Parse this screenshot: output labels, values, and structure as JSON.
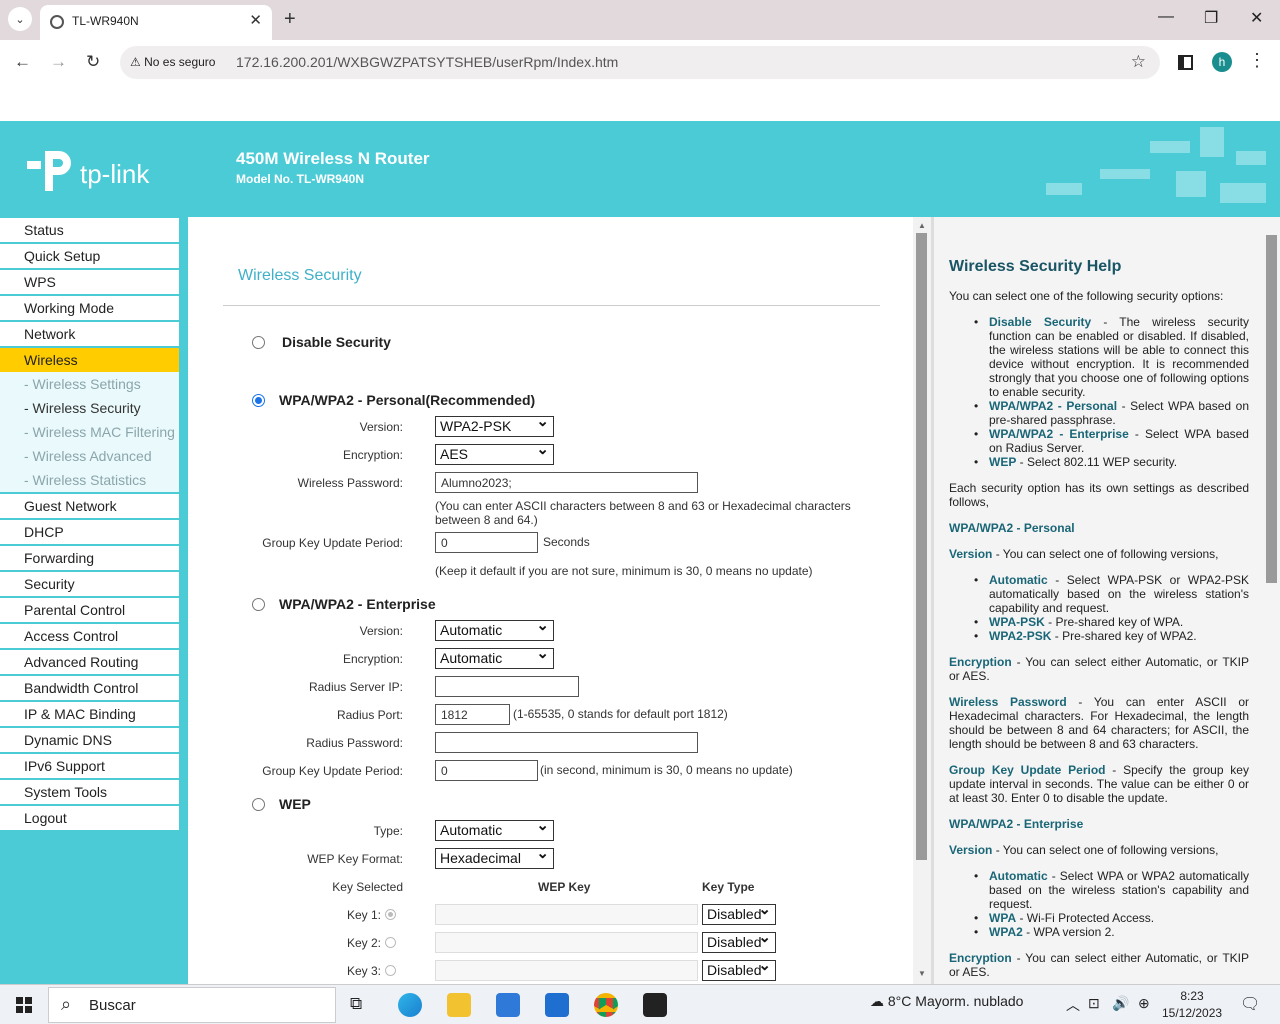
{
  "browser": {
    "tab_title": "TL-WR940N",
    "security_label": "No es seguro",
    "url": "172.16.200.201/WXBGWZPATSYTSHEB/userRpm/Index.htm",
    "avatar_letter": "h"
  },
  "header": {
    "logo_text": "tp-link",
    "product_title": "450M Wireless N Router",
    "model_no": "Model No. TL-WR940N"
  },
  "sidebar": {
    "items": [
      "Status",
      "Quick Setup",
      "WPS",
      "Working Mode",
      "Network",
      "Wireless"
    ],
    "sub_items": [
      "- Wireless Settings",
      "- Wireless Security",
      "- Wireless MAC Filtering",
      "- Wireless Advanced",
      "- Wireless Statistics"
    ],
    "items_after": [
      "Guest Network",
      "DHCP",
      "Forwarding",
      "Security",
      "Parental Control",
      "Access Control",
      "Advanced Routing",
      "Bandwidth Control",
      "IP & MAC Binding",
      "Dynamic DNS",
      "IPv6 Support",
      "System Tools",
      "Logout"
    ]
  },
  "main": {
    "page_title": "Wireless Security",
    "disable": {
      "label": "Disable Security"
    },
    "personal": {
      "label": "WPA/WPA2 - Personal(Recommended)",
      "version_label": "Version:",
      "version": "WPA2-PSK",
      "encryption_label": "Encryption:",
      "encryption": "AES",
      "password_label": "Wireless Password:",
      "password": "Alumno2023;",
      "password_note": "(You can enter ASCII characters between 8 and 63 or Hexadecimal characters between 8 and 64.)",
      "gkup_label": "Group Key Update Period:",
      "gkup": "0",
      "seconds": "Seconds",
      "gkup_note": "(Keep it default if you are not sure, minimum is 30, 0 means no update)"
    },
    "enterprise": {
      "label": "WPA/WPA2 - Enterprise",
      "version_label": "Version:",
      "version": "Automatic",
      "encryption_label": "Encryption:",
      "encryption": "Automatic",
      "radius_ip_label": "Radius Server IP:",
      "radius_ip": "",
      "radius_port_label": "Radius Port:",
      "radius_port": "1812",
      "radius_port_note": "(1-65535, 0 stands for default port 1812)",
      "radius_pw_label": "Radius Password:",
      "radius_pw": "",
      "gkup_label": "Group Key Update Period:",
      "gkup": "0",
      "gkup_note": "(in second, minimum is 30, 0 means no update)"
    },
    "wep": {
      "label": "WEP",
      "type_label": "Type:",
      "type": "Automatic",
      "format_label": "WEP Key Format:",
      "format": "Hexadecimal",
      "key_selected": "Key Selected",
      "wep_key_col": "WEP Key",
      "key_type_col": "Key Type",
      "keys": [
        {
          "label": "Key 1:",
          "type": "Disabled"
        },
        {
          "label": "Key 2:",
          "type": "Disabled"
        },
        {
          "label": "Key 3:",
          "type": "Disabled"
        }
      ]
    }
  },
  "help": {
    "title": "Wireless Security Help",
    "intro": "You can select one of the following security options:",
    "options": [
      {
        "term": "Disable Security",
        "text": " - The wireless security function can be enabled or disabled. If disabled, the wireless stations will be able to connect this device without encryption. It is recommended strongly that you choose one of following options to enable security."
      },
      {
        "term": "WPA/WPA2 - Personal",
        "text": " - Select WPA based on pre-shared passphrase."
      },
      {
        "term": "WPA/WPA2 - Enterprise",
        "text": " - Select WPA based on Radius Server."
      },
      {
        "term": "WEP",
        "text": " - Select 802.11 WEP security."
      }
    ],
    "each": "Each security option has its own settings as described follows,",
    "personal_head": "WPA/WPA2 - Personal",
    "version_term": "Version",
    "version_text": " - You can select one of following versions,",
    "versions": [
      {
        "term": "Automatic",
        "text": " - Select WPA-PSK or WPA2-PSK automatically based on the wireless station's capability and request."
      },
      {
        "term": "WPA-PSK",
        "text": " - Pre-shared key of WPA."
      },
      {
        "term": "WPA2-PSK",
        "text": " - Pre-shared key of WPA2."
      }
    ],
    "encryption_term": "Encryption",
    "encryption_text": " - You can select either Automatic, or TKIP or AES.",
    "password_term": "Wireless Password",
    "password_text": " - You can enter ASCII or Hexadecimal characters. For Hexadecimal, the length should be between 8 and 64 characters; for ASCII, the length should be between 8 and 63 characters.",
    "gkup_term": "Group Key Update Period",
    "gkup_text": " - Specify the group key update interval in seconds. The value can be either 0 or at least 30. Enter 0 to disable the update.",
    "enterprise_head": "WPA/WPA2 - Enterprise",
    "ent_versions": [
      {
        "term": "Automatic",
        "text": " - Select WPA or WPA2 automatically based on the wireless station's capability and request."
      },
      {
        "term": "WPA",
        "text": " - Wi-Fi Protected Access."
      },
      {
        "term": "WPA2",
        "text": " - WPA version 2."
      }
    ]
  },
  "taskbar": {
    "search": "Buscar",
    "temp": "8°C",
    "weather": "Mayorm. nublado",
    "time": "8:23",
    "date": "15/12/2023"
  }
}
